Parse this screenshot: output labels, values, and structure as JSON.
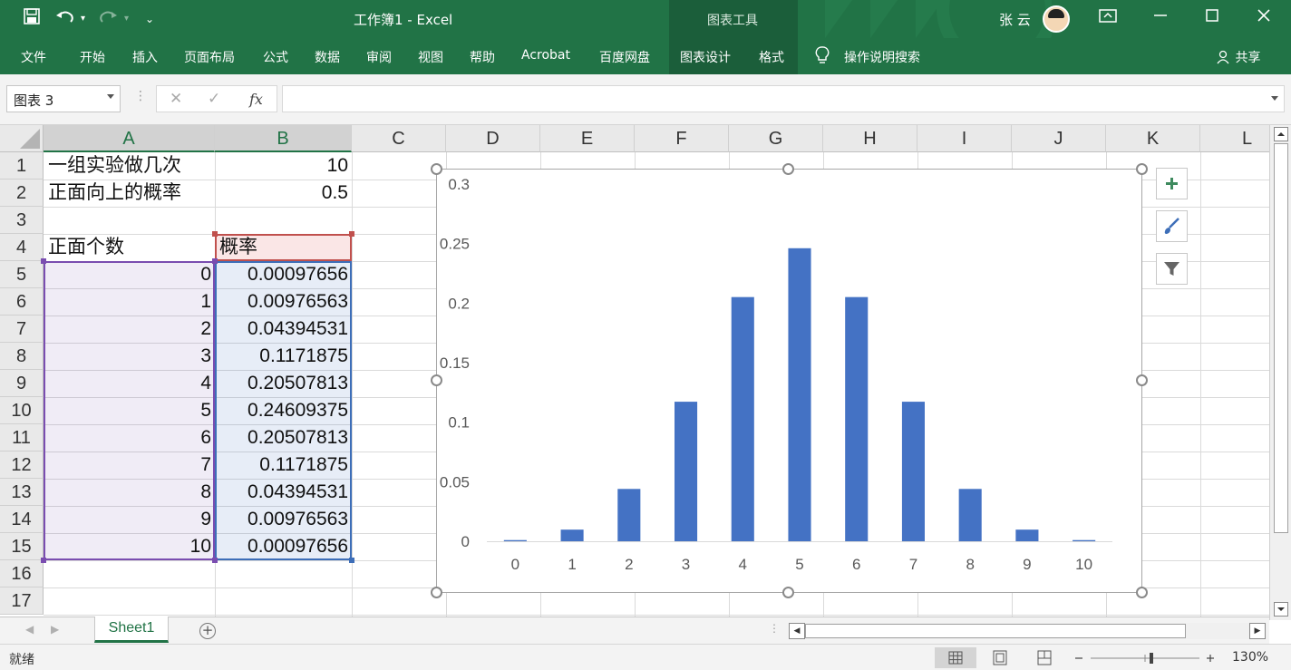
{
  "titlebar": {
    "title": "工作簿1 - Excel",
    "context_label": "图表工具",
    "user_name": "张 云"
  },
  "ribbon": {
    "tabs": [
      "文件",
      "开始",
      "插入",
      "页面布局",
      "公式",
      "数据",
      "审阅",
      "视图",
      "帮助",
      "Acrobat",
      "百度网盘",
      "图表设计",
      "格式"
    ],
    "search_label": "操作说明搜索",
    "share_label": "共享"
  },
  "formula_bar": {
    "name_box": "图表 3",
    "fx_label": "fx",
    "formula": ""
  },
  "columns": [
    "A",
    "B",
    "C",
    "D",
    "E",
    "F",
    "G",
    "H",
    "I",
    "J",
    "K",
    "L"
  ],
  "rows": [
    "1",
    "2",
    "3",
    "4",
    "5",
    "6",
    "7",
    "8",
    "9",
    "10",
    "11",
    "12",
    "13",
    "14",
    "15",
    "16",
    "17"
  ],
  "cells": {
    "A1": "一组实验做几次",
    "B1": "10",
    "A2": "正面向上的概率",
    "B2": "0.5",
    "A4": "正面个数",
    "B4": "概率",
    "A_values": [
      "0",
      "1",
      "2",
      "3",
      "4",
      "5",
      "6",
      "7",
      "8",
      "9",
      "10"
    ],
    "B_values": [
      "0.00097656",
      "0.00976563",
      "0.04394531",
      "0.1171875",
      "0.20507813",
      "0.24609375",
      "0.20507813",
      "0.1171875",
      "0.04394531",
      "0.00976563",
      "0.00097656"
    ]
  },
  "chart_data": {
    "type": "bar",
    "categories": [
      "0",
      "1",
      "2",
      "3",
      "4",
      "5",
      "6",
      "7",
      "8",
      "9",
      "10"
    ],
    "values": [
      0.00097656,
      0.00976563,
      0.04394531,
      0.1171875,
      0.20507813,
      0.24609375,
      0.20507813,
      0.1171875,
      0.04394531,
      0.00976563,
      0.00097656
    ],
    "y_ticks": [
      "0",
      "0.05",
      "0.1",
      "0.15",
      "0.2",
      "0.25",
      "0.3"
    ],
    "ylim": [
      0,
      0.3
    ],
    "title": "",
    "xlabel": "",
    "ylabel": "",
    "grid": false,
    "bar_color": "#4472C4"
  },
  "sheets": {
    "active": "Sheet1"
  },
  "status": {
    "ready": "就绪",
    "zoom": "130%"
  },
  "colors": {
    "excel_green": "#217346",
    "context_tab_bg": "#1b5e3a",
    "select_a": "#7a4db0",
    "select_b": "#3d6eb8",
    "select_header": "#c0504d"
  }
}
